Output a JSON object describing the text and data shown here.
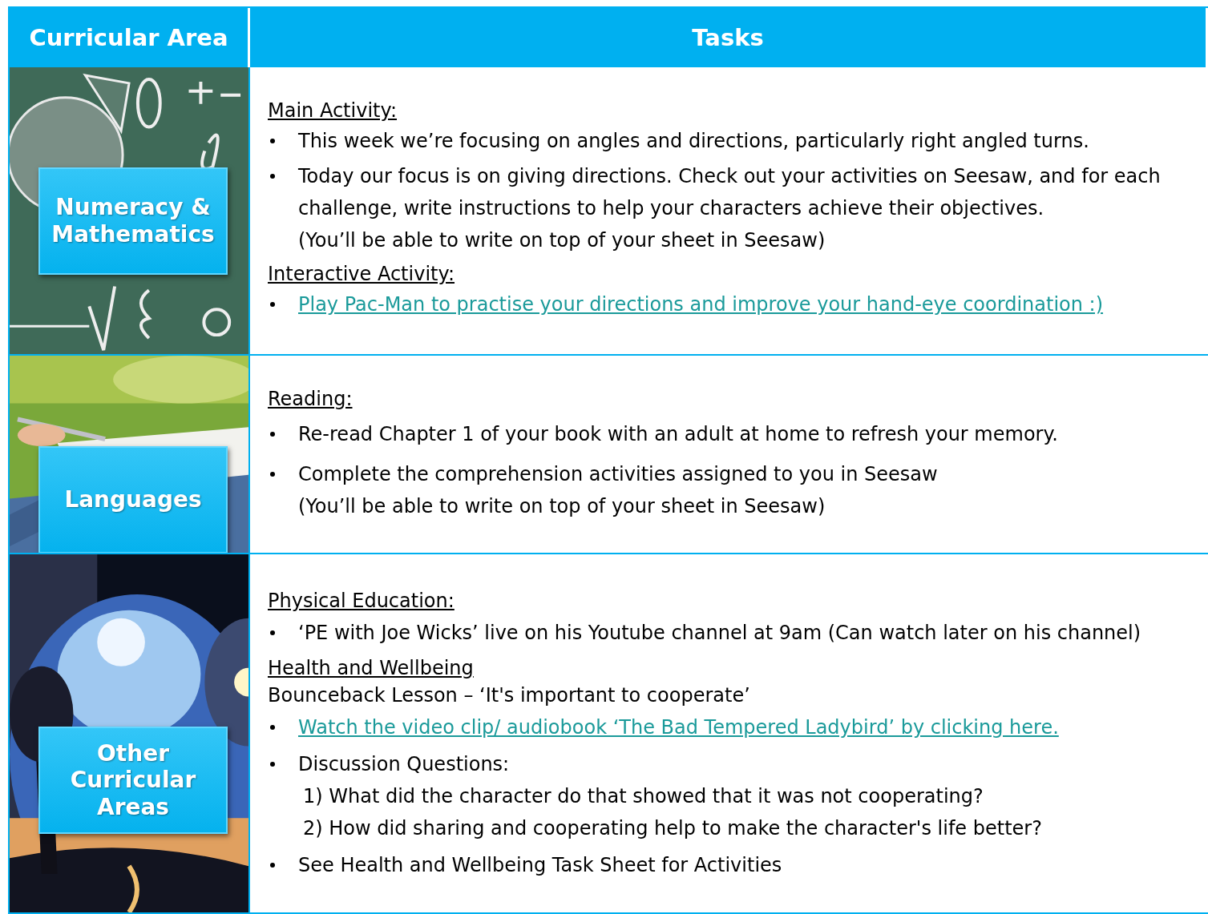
{
  "header": {
    "column_1": "Curricular Area",
    "column_2": "Tasks"
  },
  "rows": [
    {
      "area": "Numeracy & Mathematics",
      "blocks": [
        {
          "kind": "heading",
          "text": "Main Activity:"
        },
        {
          "kind": "bullet",
          "lines": [
            "This week we’re focusing on angles and directions, particularly right angled turns."
          ]
        },
        {
          "kind": "bullet",
          "lines": [
            "Today our focus is on giving directions. Check out your activities on Seesaw, and for each challenge, write instructions to help your characters achieve their objectives.",
            "(You’ll be able to write on top of your sheet in Seesaw)"
          ]
        },
        {
          "kind": "heading",
          "text": "Interactive Activity:"
        },
        {
          "kind": "link",
          "lines": [
            "Play Pac-Man to practise your directions and improve your hand-eye coordination :)"
          ]
        }
      ]
    },
    {
      "area": "Languages",
      "blocks": [
        {
          "kind": "heading",
          "text": "Reading:"
        },
        {
          "kind": "bullet",
          "lines": [
            "Re-read Chapter 1 of your book with an adult at home to refresh your memory."
          ]
        },
        {
          "kind": "bullet",
          "lines": [
            "Complete the comprehension activities assigned to you in Seesaw",
            "(You’ll be able to write on top of your sheet in Seesaw)"
          ]
        }
      ]
    },
    {
      "area": "Other Curricular Areas",
      "blocks": [
        {
          "kind": "heading",
          "text": "Physical Education:"
        },
        {
          "kind": "bullet",
          "lines": [
            "‘PE with Joe Wicks’ live on his Youtube channel at 9am (Can watch later on his channel)"
          ]
        },
        {
          "kind": "heading",
          "text": "Health and Wellbeing"
        },
        {
          "kind": "para",
          "text": "Bounceback Lesson – ‘It's important to cooperate’"
        },
        {
          "kind": "link",
          "lines": [
            "Watch the video clip/ audiobook ‘The Bad Tempered Ladybird’ by clicking here."
          ]
        },
        {
          "kind": "bullet",
          "lines": [
            "Discussion Questions:",
            " 1) What did the character do that showed that it was not cooperating?",
            " 2) How did sharing and cooperating help to make the character's life better?"
          ]
        },
        {
          "kind": "bullet",
          "lines": [
            "See Health and Wellbeing Task Sheet for Activities"
          ]
        }
      ]
    }
  ]
}
